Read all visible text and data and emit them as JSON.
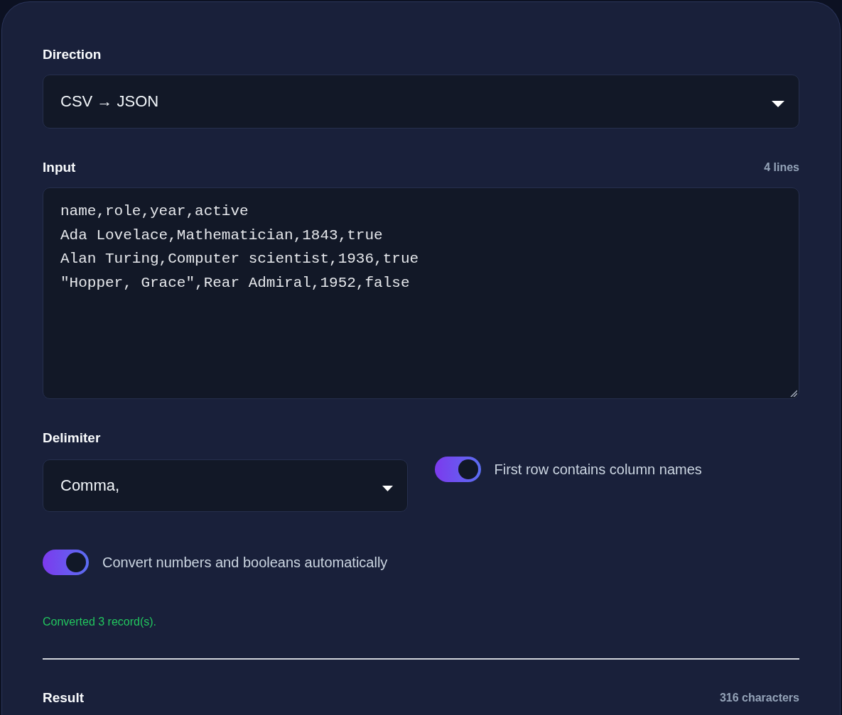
{
  "direction": {
    "label": "Direction",
    "value": "CSV → JSON"
  },
  "input": {
    "label": "Input",
    "count": "4 lines",
    "lines": [
      "name,role,year,active",
      "Ada Lovelace,Mathematician,1843,true",
      "Alan Turing,Computer scientist,1936,true",
      "\"Hopper, Grace\",Rear Admiral,1952,false"
    ]
  },
  "delimiter": {
    "label": "Delimiter",
    "value": "Comma,"
  },
  "options": [
    {
      "label": "First row contains column names",
      "on": true
    },
    {
      "label": "Convert numbers and booleans automatically",
      "on": true
    }
  ],
  "status": "Converted 3 record(s).",
  "result": {
    "label": "Result",
    "count": "316 characters"
  }
}
